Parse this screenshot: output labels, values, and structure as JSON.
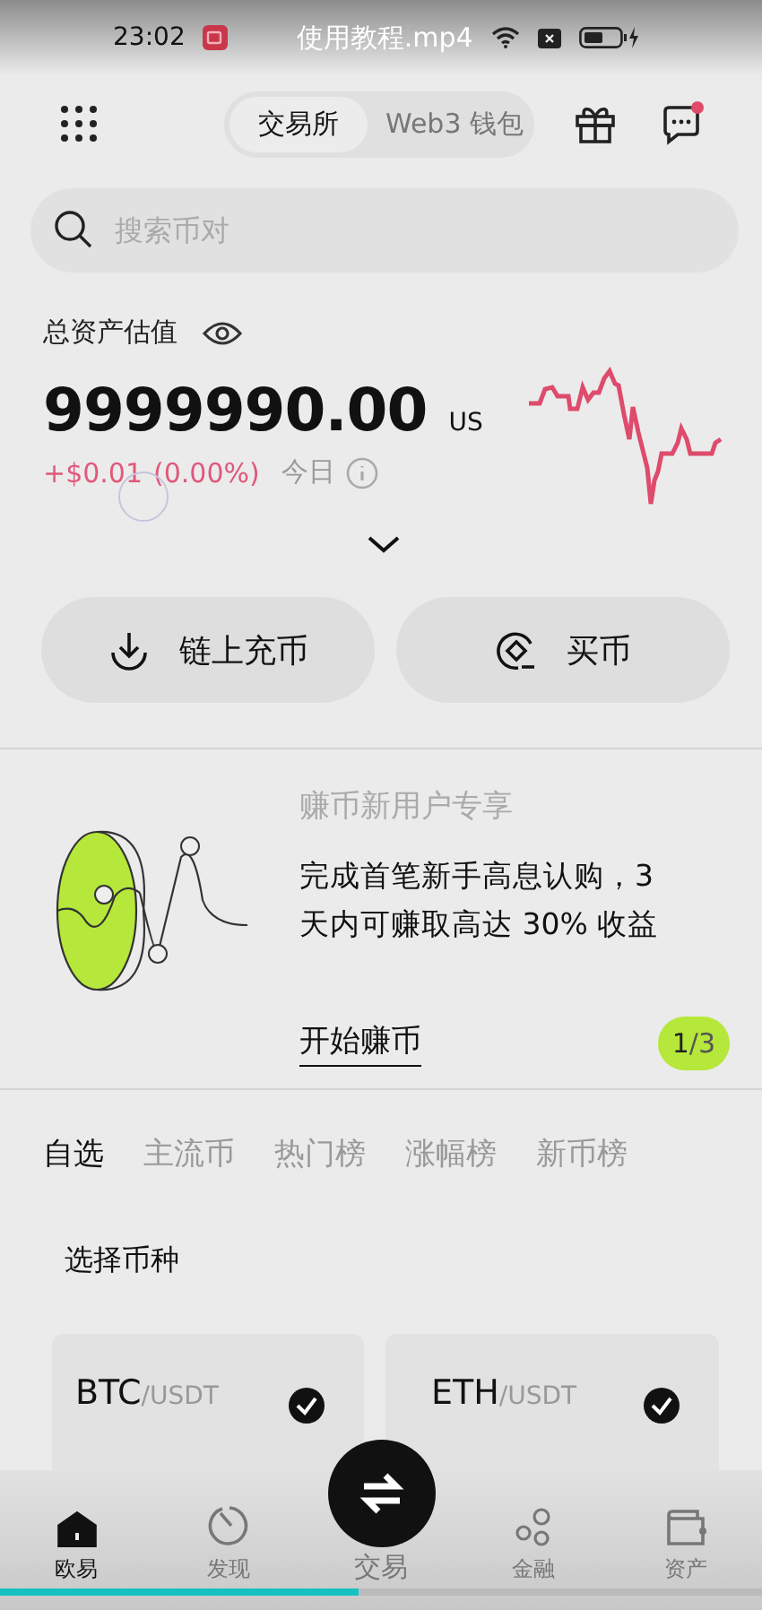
{
  "status_bar": {
    "time": "23:02",
    "video_title": "使用教程.mp4"
  },
  "header": {
    "segments": [
      {
        "label": "交易所",
        "selected": true
      },
      {
        "label": "Web3 钱包",
        "selected": false
      }
    ],
    "messages_unread": true
  },
  "search": {
    "placeholder": "搜索币对"
  },
  "assets": {
    "label": "总资产估值",
    "amount": "9999990.00",
    "currency": "US",
    "change": "+$0.01",
    "change_pct": "(0.00%)",
    "period": "今日"
  },
  "actions": [
    {
      "kind": "deposit",
      "label": "链上充币"
    },
    {
      "kind": "buy",
      "label": "买币"
    }
  ],
  "promo": {
    "title": "赚币新用户专享",
    "text": "完成首笔新手高息认购，3 天内可赚取高达 30% 收益",
    "link": "开始赚币",
    "page": "1",
    "total": "/3"
  },
  "market_tabs": [
    {
      "label": "自选",
      "selected": true
    },
    {
      "label": "主流币",
      "selected": false
    },
    {
      "label": "热门榜",
      "selected": false
    },
    {
      "label": "涨幅榜",
      "selected": false
    },
    {
      "label": "新币榜",
      "selected": false
    }
  ],
  "section_title": "选择币种",
  "pairs": [
    {
      "base": "BTC",
      "quote": "/USDT",
      "checked": true
    },
    {
      "base": "ETH",
      "quote": "/USDT",
      "checked": true
    }
  ],
  "nav": [
    {
      "kind": "home",
      "label": "欧易",
      "selected": true
    },
    {
      "kind": "discover",
      "label": "发现",
      "selected": false
    },
    {
      "kind": "trade",
      "label": "交易",
      "selected": false
    },
    {
      "kind": "finance",
      "label": "金融",
      "selected": false
    },
    {
      "kind": "assets",
      "label": "资产",
      "selected": false
    }
  ],
  "video": {
    "level": 0.47
  }
}
